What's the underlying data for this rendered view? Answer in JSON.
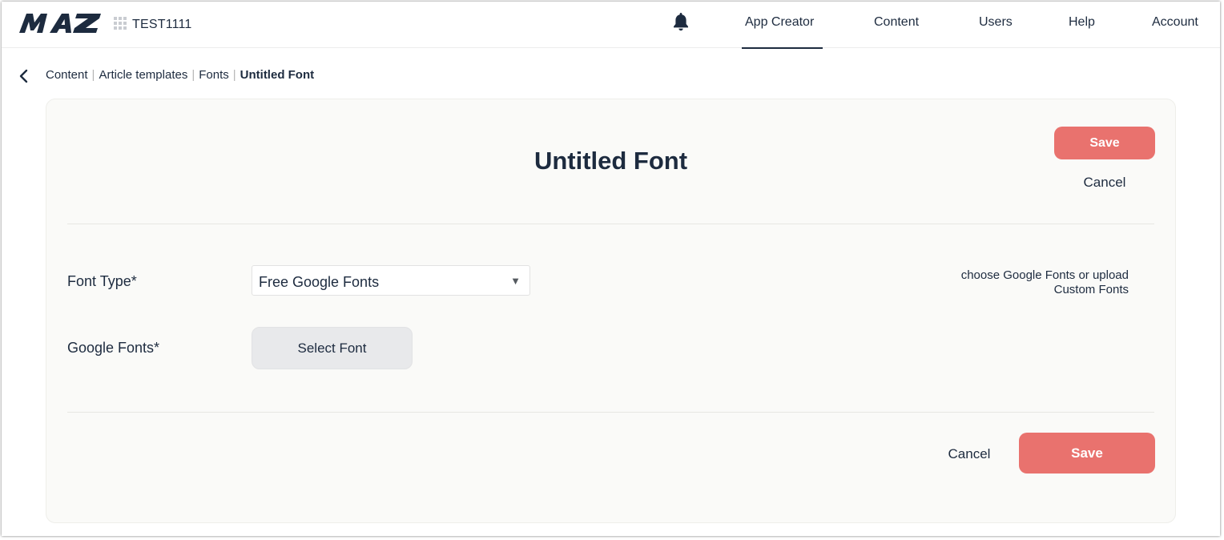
{
  "header": {
    "logo_text": "MAZ",
    "app_switcher_icon": "grid-icon",
    "app_name": "TEST1111",
    "notifications_icon": "bell-icon",
    "nav": [
      {
        "label": "App Creator",
        "active": true
      },
      {
        "label": "Content",
        "active": false
      },
      {
        "label": "Users",
        "active": false
      },
      {
        "label": "Help",
        "active": false
      },
      {
        "label": "Account",
        "active": false
      }
    ]
  },
  "breadcrumb": {
    "back_icon": "chevron-left-icon",
    "items": [
      "Content",
      "Article templates",
      "Fonts"
    ],
    "current": "Untitled Font",
    "separator": "|"
  },
  "form": {
    "title": "Untitled Font",
    "save_label": "Save",
    "cancel_label": "Cancel",
    "font_type": {
      "label": "Font Type*",
      "selected": "Free Google Fonts",
      "arrow": "▼"
    },
    "google_fonts": {
      "label": "Google Fonts*",
      "button_label": "Select Font"
    },
    "hint": "choose Google Fonts or upload Custom Fonts"
  },
  "colors": {
    "primary_text": "#1d2b3f",
    "accent": "#e9726e",
    "card_bg": "#fafaf8",
    "secondary_button_bg": "#e8e9eb"
  }
}
